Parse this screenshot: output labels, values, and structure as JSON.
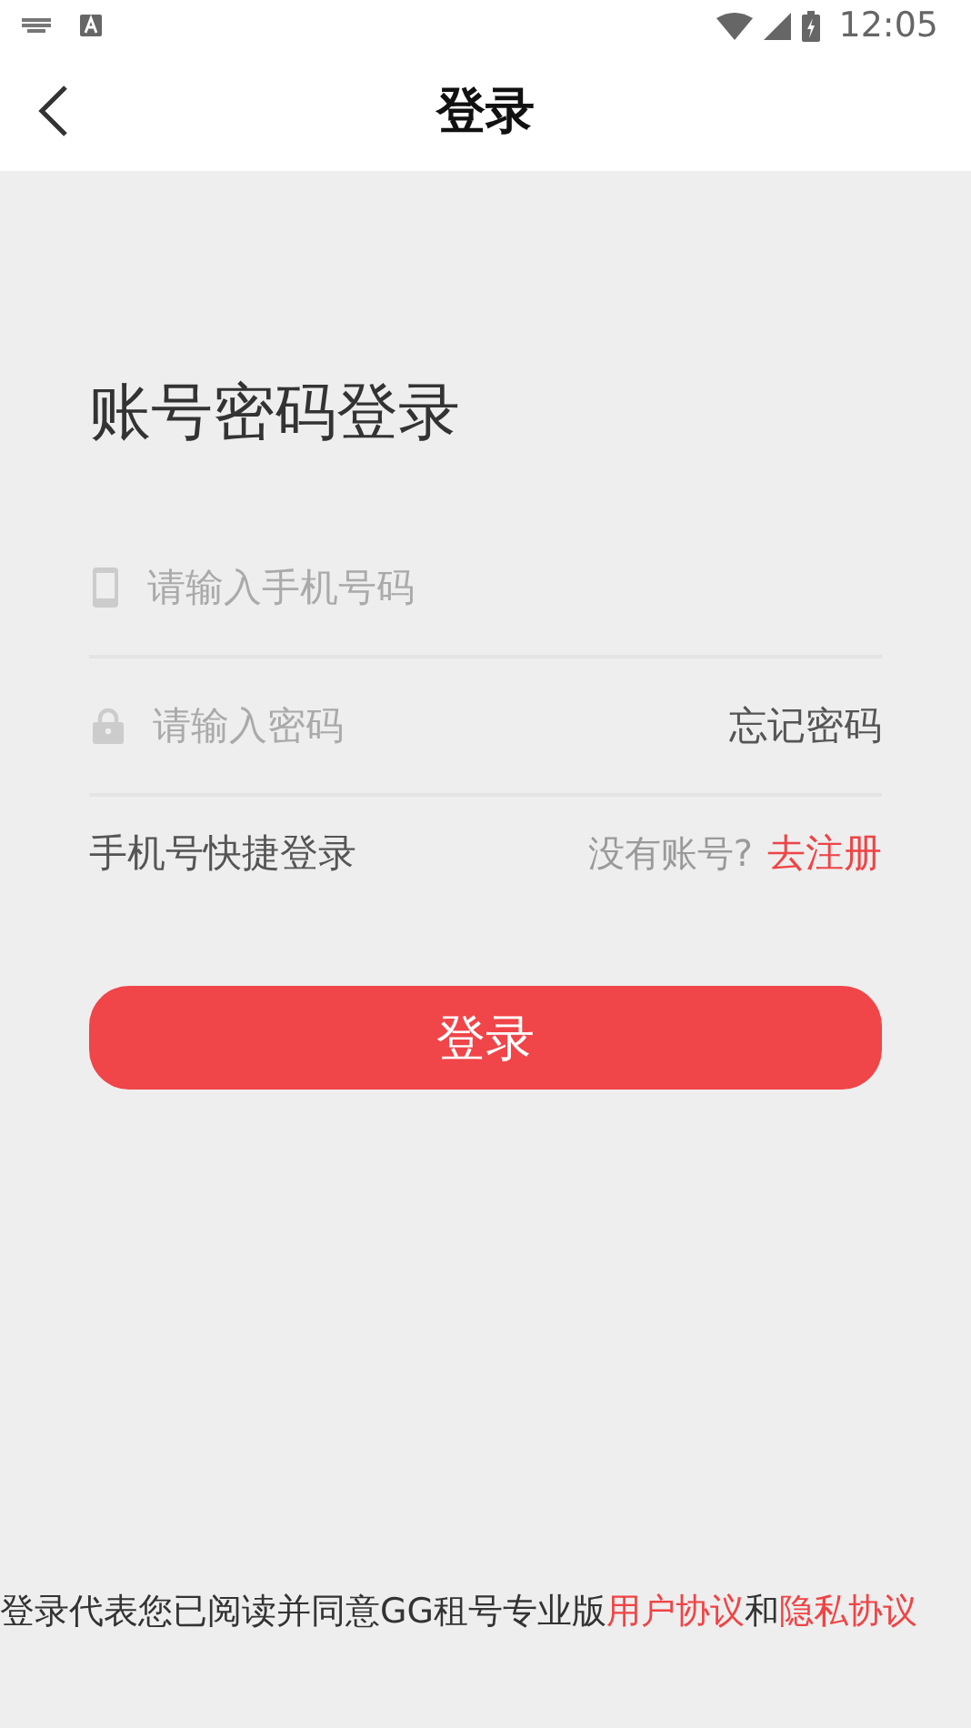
{
  "status_bar": {
    "time": "12:05"
  },
  "nav": {
    "title": "登录"
  },
  "heading": "账号密码登录",
  "phone_field": {
    "placeholder": "请输入手机号码"
  },
  "password_field": {
    "placeholder": "请输入密码",
    "forgot": "忘记密码"
  },
  "quick_login": "手机号快捷登录",
  "no_account": "没有账号?",
  "register_link": "去注册",
  "login_button": "登录",
  "agreement": {
    "text": "登录代表您已阅读并同意GG租号专业版",
    "user_agreement": "用户协议",
    "and": "和",
    "privacy_policy": "隐私协议"
  }
}
